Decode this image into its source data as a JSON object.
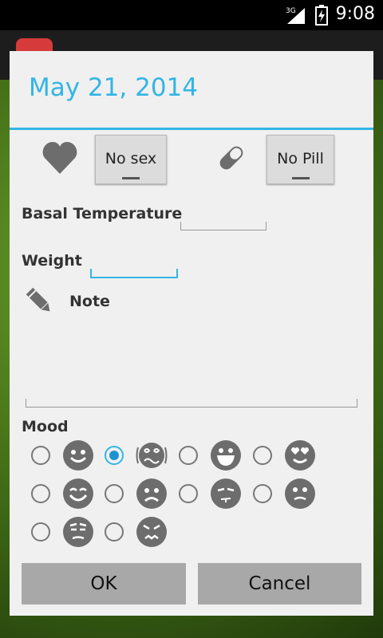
{
  "status_bar": {
    "time": "9:08",
    "network": "3G"
  },
  "dialog": {
    "title": "May 21, 2014",
    "sex_toggle": "No sex",
    "pill_toggle": "No Pill",
    "basal_label": "Basal Temperature",
    "basal_value": "",
    "weight_label": "Weight",
    "weight_value": "",
    "note_label": "Note",
    "note_value": "",
    "mood_label": "Mood",
    "moods": [
      {
        "icon": "smile-icon",
        "selected": false
      },
      {
        "icon": "dizzy-icon",
        "selected": true
      },
      {
        "icon": "grin-icon",
        "selected": false
      },
      {
        "icon": "love-eyes-icon",
        "selected": false
      },
      {
        "icon": "happy-icon",
        "selected": false
      },
      {
        "icon": "sad-icon",
        "selected": false
      },
      {
        "icon": "wink-icon",
        "selected": false
      },
      {
        "icon": "meh-icon",
        "selected": false
      },
      {
        "icon": "unamused-icon",
        "selected": false
      },
      {
        "icon": "angry-icon",
        "selected": false
      }
    ],
    "ok_label": "OK",
    "cancel_label": "Cancel"
  },
  "colors": {
    "accent": "#33b5e5",
    "icon_gray": "#6d6d6d"
  }
}
